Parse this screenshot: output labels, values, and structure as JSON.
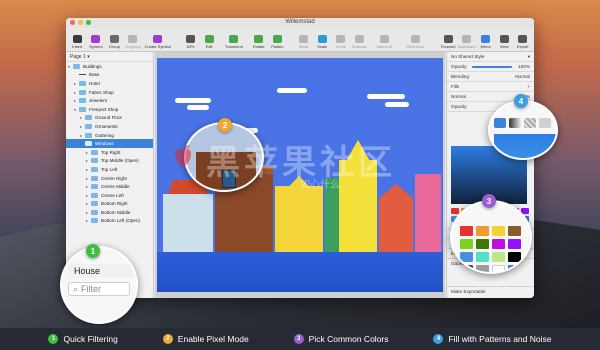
{
  "window": {
    "title": "Willemstad"
  },
  "toolbar": {
    "items": [
      {
        "label": "Insert"
      },
      {
        "label": "Symbol"
      },
      {
        "label": "Group"
      },
      {
        "label": "Ungroup"
      },
      {
        "label": "Create Symbol"
      },
      {
        "label": "83%"
      },
      {
        "label": "Edit"
      },
      {
        "label": "Transform"
      },
      {
        "label": "Rotate"
      },
      {
        "label": "Flatten"
      },
      {
        "label": "Mask"
      },
      {
        "label": "Scale"
      },
      {
        "label": "Union"
      },
      {
        "label": "Subtract"
      },
      {
        "label": "Intersect"
      },
      {
        "label": "Difference"
      },
      {
        "label": "Forward"
      },
      {
        "label": "Backward"
      },
      {
        "label": "Mirror"
      },
      {
        "label": "View"
      },
      {
        "label": "Export"
      }
    ]
  },
  "layers": {
    "page": "Page 1",
    "items": [
      {
        "label": "Buildings",
        "type": "folder",
        "depth": 0,
        "open": true
      },
      {
        "label": "Base",
        "type": "shape",
        "depth": 1
      },
      {
        "label": "Hotel",
        "type": "folder",
        "depth": 1
      },
      {
        "label": "Fabric Shop",
        "type": "folder",
        "depth": 1
      },
      {
        "label": "Jewelers",
        "type": "folder",
        "depth": 1
      },
      {
        "label": "Freeport Shop",
        "type": "folder",
        "depth": 1,
        "open": true
      },
      {
        "label": "Ground Floor",
        "type": "folder",
        "depth": 2
      },
      {
        "label": "Ornaments",
        "type": "folder",
        "depth": 2
      },
      {
        "label": "Guttering",
        "type": "folder",
        "depth": 2
      },
      {
        "label": "Windows",
        "type": "folder",
        "depth": 2,
        "open": true
      },
      {
        "label": "Top Right",
        "type": "folder",
        "depth": 3
      },
      {
        "label": "Top Middle (Open)",
        "type": "folder",
        "depth": 3
      },
      {
        "label": "Top Left",
        "type": "folder",
        "depth": 3
      },
      {
        "label": "Centre Right",
        "type": "folder",
        "depth": 3
      },
      {
        "label": "Centre Middle",
        "type": "folder",
        "depth": 3
      },
      {
        "label": "Centre Left",
        "type": "folder",
        "depth": 3
      },
      {
        "label": "Bottom Right",
        "type": "folder",
        "depth": 3
      },
      {
        "label": "Bottom Middle",
        "type": "folder",
        "depth": 3
      },
      {
        "label": "Bottom Left (Open)",
        "type": "folder",
        "depth": 3
      }
    ],
    "zoomed_item": "House",
    "filter_placeholder": "Filter"
  },
  "inspector": {
    "shared_style": "No Shared Style",
    "opacity_label": "Opacity",
    "opacity_value": "100%",
    "blending_label": "Blending",
    "blending_value": "Normal",
    "fills_label": "Fills",
    "fill_mode": "Normal",
    "fill_opacity_label": "Opacity",
    "fill_percent": "100%",
    "borders_label": "Borders",
    "shadows_label": "Shadows",
    "inner_shadows_label": "Inner Shadows",
    "blur_label": "Gaussian Blur",
    "exportable_label": "Make Exportable",
    "swatch_colors": [
      "#e8312f",
      "#f19b2c",
      "#f7d230",
      "#8b5a2b",
      "#7ed321",
      "#417505",
      "#bd10e0",
      "#9013fe",
      "#4a90e2",
      "#50e3c2",
      "#b8e986",
      "#000000",
      "#4a4a4a",
      "#9b9b9b",
      "#ffffff",
      "#2d7de0"
    ]
  },
  "callouts": [
    {
      "number": "1",
      "color": "#3fbf3f"
    },
    {
      "number": "2",
      "color": "#f0a830"
    },
    {
      "number": "3",
      "color": "#9a5fd0"
    },
    {
      "number": "4",
      "color": "#3a9ee0"
    }
  ],
  "features": [
    {
      "number": "1",
      "label": "Quick Filtering",
      "color": "#3fbf3f"
    },
    {
      "number": "2",
      "label": "Enable Pixel Mode",
      "color": "#f0a830"
    },
    {
      "number": "3",
      "label": "Pick Common Colors",
      "color": "#9a5fd0"
    },
    {
      "number": "4",
      "label": "Fill with Patterns and Noise",
      "color": "#3a9ee0"
    }
  ],
  "watermark": {
    "text": "黑苹果社区",
    "sub": "如心什么"
  }
}
